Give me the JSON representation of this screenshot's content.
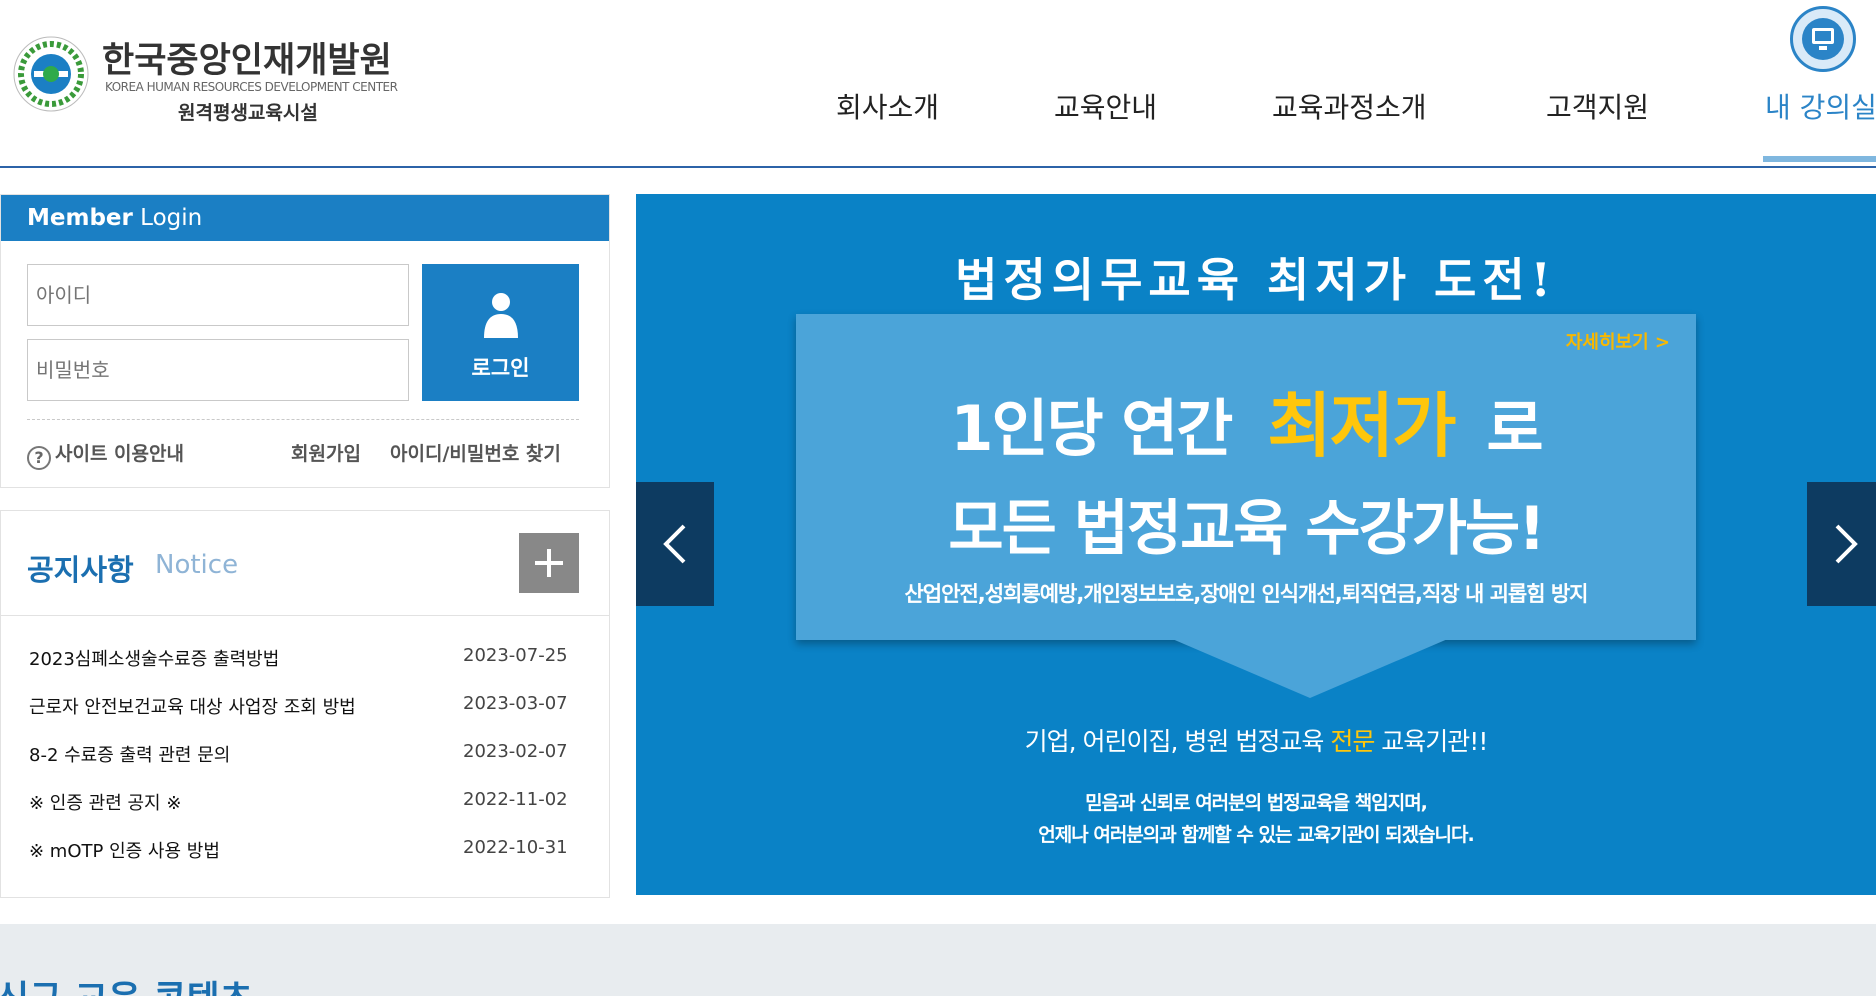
{
  "header": {
    "logo_ko": "한국중앙인재개발원",
    "logo_en": "KOREA HUMAN RESOURCES DEVELOPMENT CENTER",
    "logo_sub": "원격평생교육시설",
    "nav": [
      "회사소개",
      "교육안내",
      "교육과정소개",
      "고객지원",
      "내 강의실"
    ],
    "active_nav": "내 강의실",
    "accent_color": "#2b84c7"
  },
  "login": {
    "title_bold": "Member",
    "title_rest": " Login",
    "id_placeholder": "아이디",
    "pw_placeholder": "비밀번호",
    "button_label": "로그인",
    "site_guide": "사이트 이용안내",
    "help_glyph": "?",
    "signup": "회원가입",
    "find_account": "아이디/비밀번호 찾기"
  },
  "notice": {
    "title": "공지사항",
    "title_en": "Notice",
    "items": [
      {
        "title": "2023심폐소생술수료증 출력방법",
        "date": "2023-07-25"
      },
      {
        "title": "근로자 안전보건교육 대상 사업장 조회 방법",
        "date": "2023-03-07"
      },
      {
        "title": "8-2 수료증 출력 관련 문의",
        "date": "2023-02-07"
      },
      {
        "title": "※ 인증 관련 공지 ※",
        "date": "2022-11-02"
      },
      {
        "title": "※ mOTP 인증 사용 방법",
        "date": "2022-10-31"
      }
    ]
  },
  "banner": {
    "headline": "법정의무교육 최저가 도전!",
    "more": "자세히보기 >",
    "line1_pre": "1인당 연간",
    "line1_hl": "최저가",
    "line1_post": "로",
    "line2": "모든 법정교육 수강가능!",
    "line3": "산업안전,성희롱예방,개인정보보호,장애인 인식개선,퇴직연금,직장 내 괴롭힘 방지",
    "line4_pre": "기업, 어린이집, 병원 법정교육 ",
    "line4_hl": "전문",
    "line4_post": " 교육기관!!",
    "line5": "믿음과 신뢰로 여러분의 법정교육을 책임지며,",
    "line6": "언제나 여러분의과 함께할 수 있는 교육기관이 되겠습니다.",
    "bg_color": "#0a82c6",
    "highlight_color": "#ffc60b"
  },
  "bottom": {
    "title": "신규 교육 콘텐츠"
  }
}
